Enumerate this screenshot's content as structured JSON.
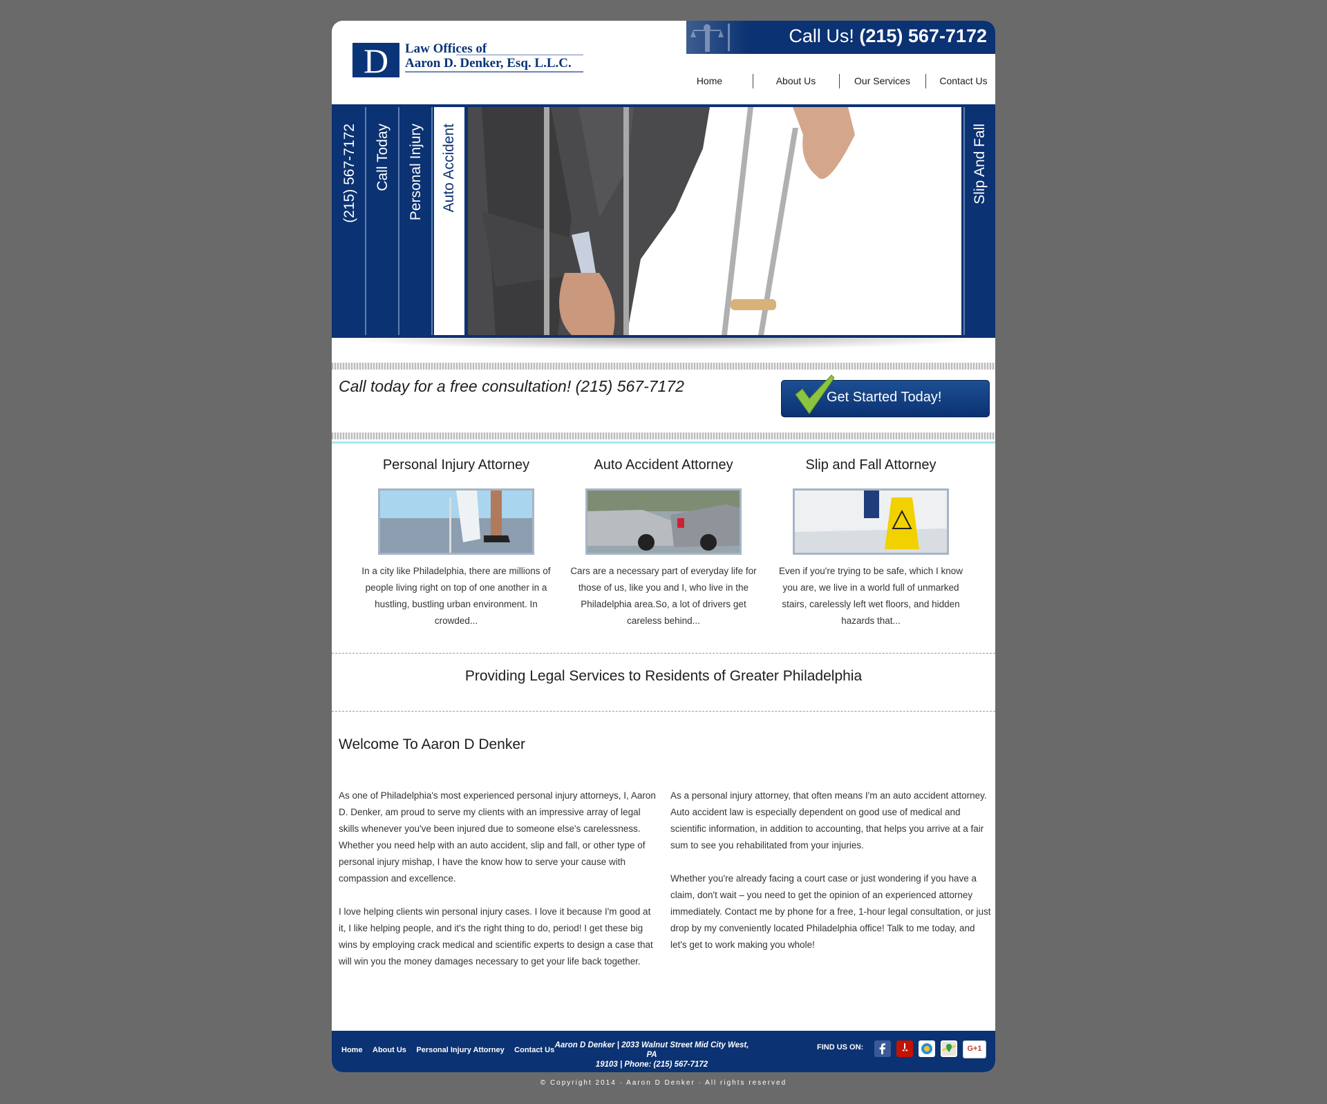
{
  "header": {
    "logo_line1": "Law Offices of",
    "logo_line2": "Aaron D. Denker, Esq. L.L.C.",
    "logo_letter": "D",
    "call_prefix": "Call Us!",
    "call_number": "(215) 567-7172"
  },
  "nav": [
    {
      "label": "Home"
    },
    {
      "label": "About Us"
    },
    {
      "label": "Our Services"
    },
    {
      "label": "Contact Us"
    }
  ],
  "hero": {
    "tabs": [
      "(215) 567-7172",
      "Call Today",
      "Personal Injury",
      "Auto Accident"
    ],
    "right_tab": "Slip And Fall"
  },
  "consult": {
    "text": "Call today for a free consultation! (215) 567-7172",
    "cta_label": "Get Started Today!"
  },
  "services": [
    {
      "title": "Personal Injury Attorney",
      "text": "In a city like Philadelphia, there are millions of people living right on top of one another in a hustling, bustling urban environment. In crowded..."
    },
    {
      "title": "Auto Accident Attorney",
      "text": "Cars are a necessary part of everyday life for those of us, like you and I, who live in the Philadelphia area.So, a lot of drivers get careless behind..."
    },
    {
      "title": "Slip and Fall Attorney",
      "text": "Even if you're trying to be safe, which I know you are, we live in a world full of unmarked stairs, carelessly left wet floors, and hidden hazards that..."
    }
  ],
  "tagline": "Providing Legal Services to Residents of Greater Philadelphia",
  "welcome": {
    "heading": "Welcome To Aaron D Denker",
    "left": [
      "As one of Philadelphia's most experienced personal injury attorneys, I, Aaron D. Denker, am proud to serve my clients with an impressive array of legal skills whenever you've been injured due to someone else's carelessness. Whether you need help with an auto accident, slip and fall, or other type of personal injury mishap, I have the know how to serve your cause with compassion and excellence.",
      "I love helping clients win personal injury cases. I love it because I'm good at it, I like helping people, and it's the right thing to do, period! I get these big wins by employing crack medical and scientific experts to design a case that will win you the money damages necessary to get your life back together."
    ],
    "right": [
      "As a personal injury attorney, that often means I'm an auto accident attorney. Auto accident law is especially dependent on good use of medical and scientific information, in addition to accounting, that helps you arrive at a fair sum to see you rehabilitated from your injuries.",
      "Whether you're already facing a court case or just wondering if you have a claim, don't wait – you need to get the opinion of an experienced attorney immediately. Contact me by phone for a free, 1-hour legal consultation, or just drop by my conveniently located Philadelphia office! Talk to me today, and let's get to work making you whole!"
    ]
  },
  "footer": {
    "links": [
      "Home",
      "About Us",
      "Personal Injury Attorney",
      "Contact Us"
    ],
    "address_line1": "Aaron D Denker | 2033 Walnut Street Mid City West, PA",
    "address_line2": "19103 | Phone: (215) 567-7172",
    "find_us": "FIND US ON:",
    "social_icons": [
      "facebook-icon",
      "yelp-icon",
      "citysearch-icon",
      "google-maps-icon",
      "google-plus-icon"
    ],
    "gplus_label": "G+1",
    "copyright": "© Copyright 2014 · Aaron D Denker · All rights reserved"
  },
  "colors": {
    "brand": "#0b3272",
    "accent": "#a8e7ee",
    "check": "#8bc53f"
  }
}
